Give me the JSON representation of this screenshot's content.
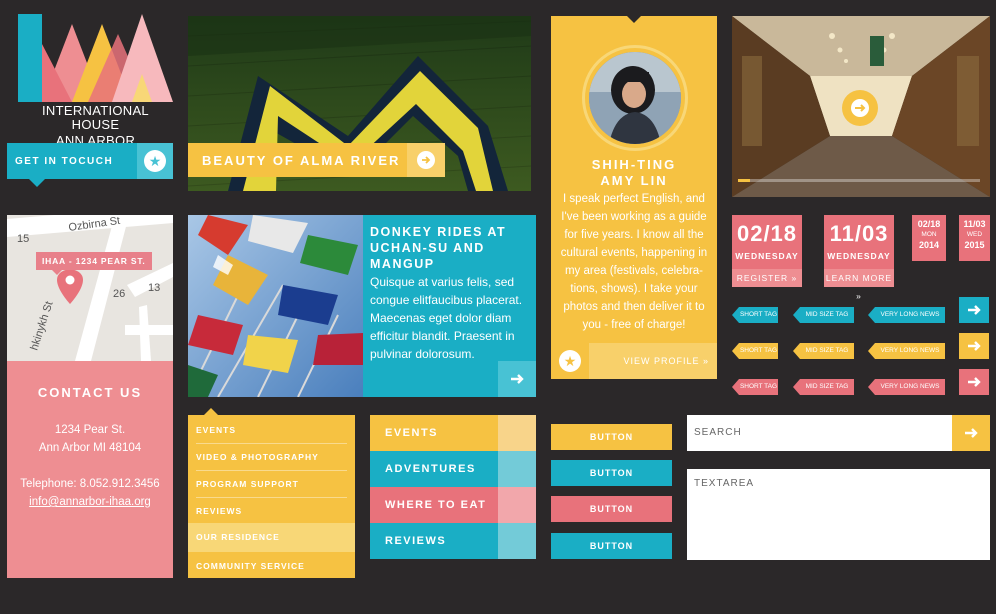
{
  "logo": {
    "line1": "INTERNATIONAL HOUSE",
    "line2": "ANN ARBOR"
  },
  "get_in_touch": {
    "label": "GET IN TOCUCH"
  },
  "hero": {
    "banner": "BEAUTY OF ALMA RIVER"
  },
  "profile": {
    "first_name": "SHIH-TING",
    "last_name": "AMY LIN",
    "bio": "I speak perfect English, and I've been working as a guide for five years. I know all the cultural events, happening in my area (festivals, celebra- tions, shows). I take your photos and then deliver it to you - free of charge!",
    "view_label": "VIEW PROFILE »"
  },
  "media": {
    "progress": 0.05
  },
  "map": {
    "tag": "IHAA - 1234 PEAR ST.",
    "labels": {
      "street1": "Ozbirna St",
      "street2": "hkinykh St",
      "n15": "15",
      "n26": "26",
      "n13": "13"
    }
  },
  "contact": {
    "title": "CONTACT US",
    "address1": "1234 Pear St.",
    "address2": "Ann Arbor MI 48104",
    "phone": "Telephone: 8.052.912.3456",
    "email": "info@annarbor-ihaa.org"
  },
  "article": {
    "title": "DONKEY RIDES AT UCHAN-SU AND MANGUP",
    "body": "Quisque at varius felis, sed congue elitfaucibus placerat. Maecenas eget dolor diam efficitur blandit. Praesent in pulvinar dolorosum."
  },
  "menu": {
    "items": [
      "EVENTS",
      "VIDEO & PHOTOGRAPHY",
      "PROGRAM SUPPORT",
      "REVIEWS",
      "OUR RESIDENCE",
      "COMMUNITY SERVICE"
    ],
    "active_index": 4
  },
  "categories": [
    "EVENTS",
    "ADVENTURES",
    "WHERE TO EAT",
    "REVIEWS"
  ],
  "buttons": [
    "BUTTON",
    "BUTTON",
    "BUTTON",
    "BUTTON"
  ],
  "dates": {
    "big": [
      {
        "date": "02/18",
        "weekday": "WEDNESDAY",
        "action": "REGISTER »"
      },
      {
        "date": "11/03",
        "weekday": "WEDNESDAY",
        "action": "LEARN MORE »"
      }
    ],
    "small": [
      {
        "date": "02/18",
        "weekday": "MON",
        "year": "2014"
      },
      {
        "date": "11/03",
        "weekday": "WED",
        "year": "2015"
      }
    ]
  },
  "tags": {
    "short": "SHORT TAG",
    "mid": "MID SIZE TAG",
    "long": "VERY LONG NEWS TAG"
  },
  "search": {
    "placeholder": "SEARCH"
  },
  "textarea": {
    "placeholder": "TEXTAREA"
  },
  "colors": {
    "yellow": "#f6c242",
    "teal": "#1aaec5",
    "pink": "#e8727b",
    "light_pink": "#ee8e92",
    "dark": "#2b2829"
  }
}
